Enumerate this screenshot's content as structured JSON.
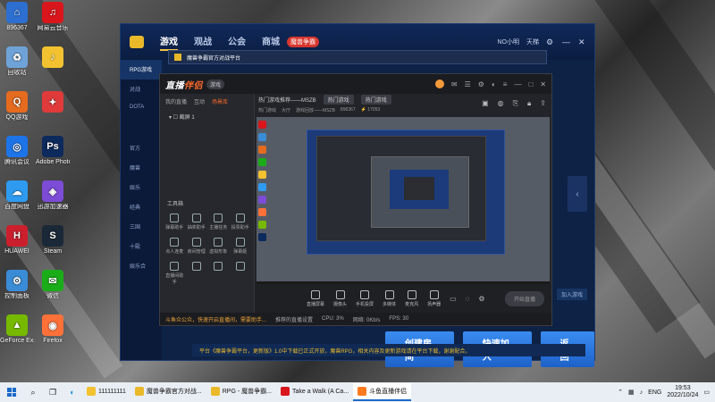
{
  "desktop": {
    "icons_left": [
      {
        "label": "896367",
        "color": "#2d6fd0",
        "glyph": "⌂"
      },
      {
        "label": "回收站",
        "color": "#6fa3d8",
        "glyph": "♻"
      },
      {
        "label": "QQ游戏",
        "color": "#e56b1f",
        "glyph": "Q"
      },
      {
        "label": "腾讯会议",
        "color": "#1d74e8",
        "glyph": "◎"
      },
      {
        "label": "百度网盘",
        "color": "#2e9bf0",
        "glyph": "☁"
      },
      {
        "label": "HUAWEI",
        "color": "#cc1f2d",
        "glyph": "H"
      },
      {
        "label": "控制面板",
        "color": "#3a8cd6",
        "glyph": "⚙"
      },
      {
        "label": "GeForce Experience",
        "color": "#76b900",
        "glyph": "▲"
      }
    ],
    "icons_right": [
      {
        "label": "网易云音乐",
        "color": "#d8161c",
        "glyph": "♫"
      },
      {
        "label": "",
        "color": "#f2c230",
        "glyph": "♪"
      },
      {
        "label": "",
        "color": "#e03a3a",
        "glyph": "✦"
      },
      {
        "label": "Adobe Photoshop",
        "color": "#0d2a5c",
        "glyph": "Ps"
      },
      {
        "label": "迅游加速器",
        "color": "#7c4cd6",
        "glyph": "◈"
      },
      {
        "label": "Steam",
        "color": "#1b2838",
        "glyph": "S"
      },
      {
        "label": "微信",
        "color": "#1aad19",
        "glyph": "✉"
      },
      {
        "label": "Firefox",
        "color": "#ff7139",
        "glyph": "◉"
      }
    ]
  },
  "platform": {
    "nav": [
      "游戏",
      "观战",
      "公会",
      "商城"
    ],
    "badge": "魔兽争霸",
    "user_name": "NO小明",
    "user_right": "天梯",
    "side_items": [
      "RPG游戏",
      "对战",
      "DOTA",
      "",
      "官方",
      "魔兽",
      "娱乐",
      "经典",
      "三国",
      "十殿",
      "娱乐合"
    ],
    "buttons": [
      "创建房间",
      "快速加入",
      "返回"
    ],
    "join_hint": "加入游戏",
    "banner": "平台《魔兽争霸平台，更新版》1.0中下载已正式开放，魔兽RPG，相关内容及更新游戏请在平台下载，谢谢配合。"
  },
  "manager_bar": {
    "title": "魔兽争霸官方对战平台"
  },
  "live": {
    "logo_a": "直播",
    "logo_b": "伴侣",
    "version": "游戏",
    "tabs": [
      "我的直播",
      "互动",
      "场景库"
    ],
    "scene": "截屏 1",
    "tools_title": "工具箱",
    "tools": [
      "弹幕助手",
      "抽奖助手",
      "主播任务",
      "投票助手",
      "点人连麦",
      "房间管理",
      "虚拟形象",
      "弹幕姬",
      "直播间助手",
      "",
      "",
      ""
    ],
    "info_line": "热门游戏推荐——MSZB",
    "info_pill": "热门游戏",
    "info_pill2": "热门游戏",
    "info2": [
      "热门游戏",
      "大厅",
      "游戏回放——MSZB",
      "896367",
      "⚡ 17053"
    ],
    "bottom_tools": [
      "直播屏幕",
      "摄像头",
      "手机投屏",
      "多媒体",
      "麦克风",
      "扬声器"
    ],
    "start_label": "开始直播",
    "status": [
      "斗鱼众公众，快速开启直播间，需要助手...",
      "推荐的直播设置",
      "CPU: 3%",
      "网络: 0Kb/s",
      "FPS: 30"
    ]
  },
  "taskbar": {
    "search_text": "111111111",
    "tasks": [
      {
        "label": "魔兽争霸官方对战...",
        "color": "#e9b92a"
      },
      {
        "label": "RPG - 魔兽争霸...",
        "color": "#e9b92a"
      },
      {
        "label": "Take a Walk (A Ca...",
        "color": "#d8161c"
      },
      {
        "label": "斗鱼直播伴侣",
        "color": "#ff7a1f"
      }
    ],
    "lang": "ENG",
    "time": "19:53",
    "date": "2022/10/24"
  }
}
